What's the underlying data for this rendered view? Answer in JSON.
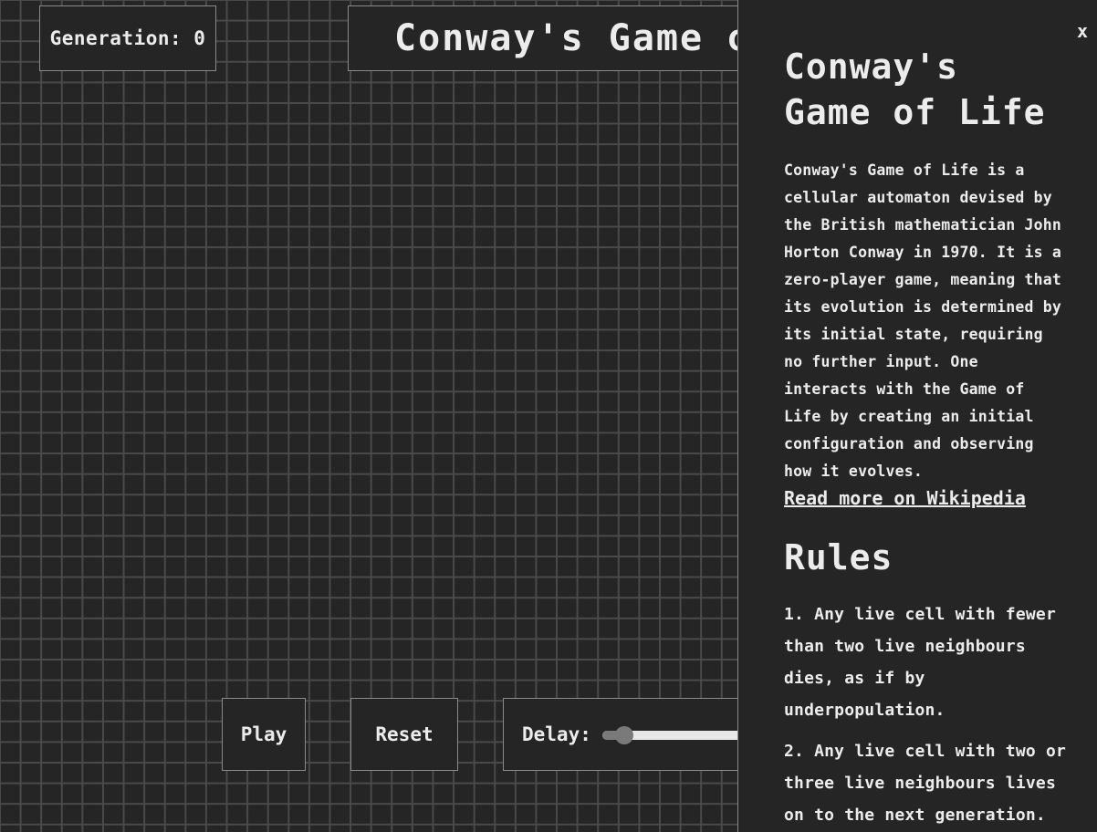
{
  "game": {
    "generation_label": "Generation: 0",
    "title": "Conway's Game of Life"
  },
  "controls": {
    "play_label": "Play",
    "reset_label": "Reset",
    "delay_label": "Delay:",
    "delay_fraction": 0.15
  },
  "sidebar": {
    "close_label": "x",
    "title": "Conway's Game of Life",
    "description": "Conway's Game of Life is a cellular automaton devised by the British mathematician John Horton Conway in 1970. It is a zero-player game, meaning that its evolution is determined by its initial state, requiring no further input. One interacts with the Game of Life by creating an initial configuration and observing how it evolves.",
    "link_label": "Read more on Wikipedia",
    "rules_heading": "Rules",
    "rules": [
      "1. Any live cell with fewer than two live neighbours dies, as if by underpopulation.",
      "2. Any live cell with two or three live neighbours lives on to the next generation."
    ]
  },
  "colors": {
    "background": "#252525",
    "grid_line": "#4a4a4a",
    "text": "#ececec",
    "border": "#8a8a8a"
  }
}
